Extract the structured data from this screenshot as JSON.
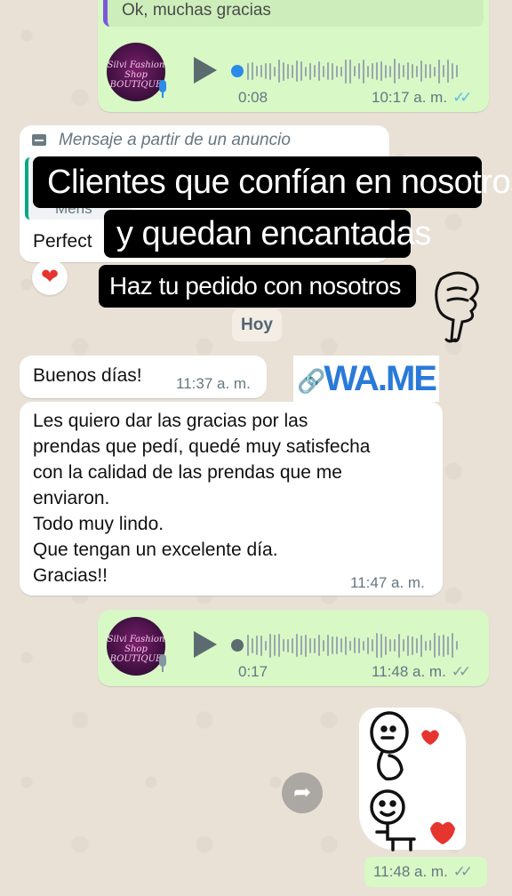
{
  "messages": {
    "audio1": {
      "quote_text": "Ok, muchas gracias",
      "duration": "0:08",
      "time": "10:17 a. m.",
      "ticks": "✓✓",
      "avatar_text": "Silvi Fashion Shop BOUTIQUE"
    },
    "ad_message": {
      "header": "Mensaje a partir de un anuncio",
      "partial_quote": "Mens",
      "partial_text": "Perfect"
    },
    "reaction": "❤",
    "date_divider": "Hoy",
    "greeting": {
      "text": "Buenos días!",
      "time": "11:37 a. m."
    },
    "thanks": {
      "lines": [
        "Les quiero dar las gracias por las",
        "prendas que pedí, quedé muy satisfecha",
        "con la calidad de las prendas que me",
        "enviaron.",
        "Todo muy lindo.",
        "Que tengan un excelente día.",
        "Gracias!!"
      ],
      "time": "11:47 a. m."
    },
    "audio2": {
      "duration": "0:17",
      "time": "11:48 a. m.",
      "ticks": "✓✓",
      "avatar_text": "Silvi Fashion Shop BOUTIQUE"
    },
    "sticker": {
      "time": "11:48 a. m.",
      "ticks": "✓✓"
    }
  },
  "overlay": {
    "line1": "Clientes que confían en nosotros",
    "line2": "y quedan encantadas",
    "line3": "Haz tu pedido con nosotros",
    "wame": "WA.ME",
    "link_icon": "🔗"
  },
  "icons": {
    "forward": "➦",
    "hand": "hand-pointing-down-icon"
  },
  "colors": {
    "out_bubble": "#d8f8c6",
    "in_bubble": "#ffffff",
    "read_tick": "#53bdeb",
    "wame_blue": "#2a7ad8"
  }
}
